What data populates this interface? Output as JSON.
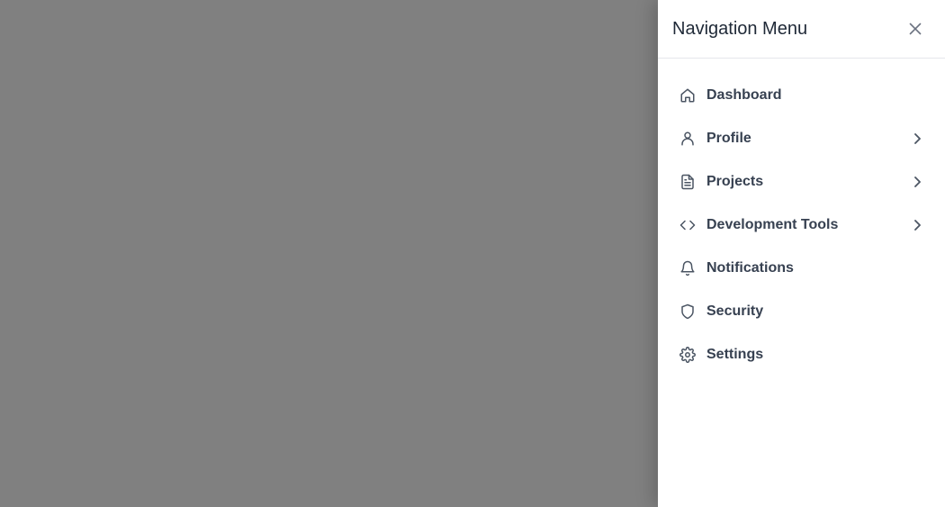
{
  "drawer": {
    "title": "Navigation Menu",
    "close_icon": "close-icon"
  },
  "menu": {
    "items": [
      {
        "label": "Dashboard",
        "icon": "home-icon",
        "has_submenu": false
      },
      {
        "label": "Profile",
        "icon": "user-icon",
        "has_submenu": true
      },
      {
        "label": "Projects",
        "icon": "document-icon",
        "has_submenu": true
      },
      {
        "label": "Development Tools",
        "icon": "code-icon",
        "has_submenu": true
      },
      {
        "label": "Notifications",
        "icon": "bell-icon",
        "has_submenu": false
      },
      {
        "label": "Security",
        "icon": "shield-icon",
        "has_submenu": false
      },
      {
        "label": "Settings",
        "icon": "gear-icon",
        "has_submenu": false
      }
    ]
  },
  "colors": {
    "overlay": "#808080",
    "drawer_bg": "#ffffff",
    "text": "#374151",
    "title": "#1f2937",
    "icon": "#4b5563"
  }
}
